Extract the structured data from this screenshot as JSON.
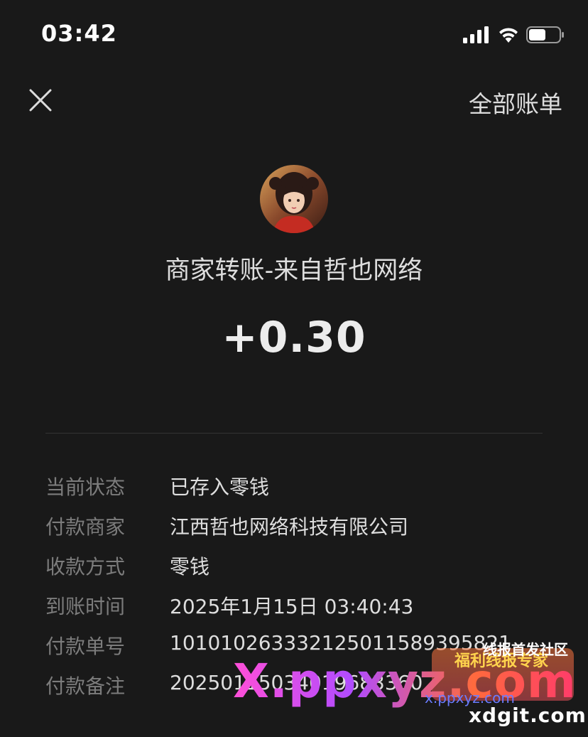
{
  "status_bar": {
    "time": "03:42",
    "signal_icon": "cellular-signal-icon",
    "wifi_icon": "wifi-icon",
    "battery_icon": "battery-icon",
    "battery_level": 0.55
  },
  "nav": {
    "close_icon": "close-icon",
    "all_bills_label": "全部账单"
  },
  "transaction": {
    "avatar_icon": "merchant-avatar",
    "title": "商家转账-来自哲也网络",
    "amount": "+0.30"
  },
  "details": [
    {
      "label": "当前状态",
      "value": "已存入零钱"
    },
    {
      "label": "付款商家",
      "value": "江西哲也网络科技有限公司"
    },
    {
      "label": "收款方式",
      "value": "零钱"
    },
    {
      "label": "到账时间",
      "value": "2025年1月15日 03:40:43"
    },
    {
      "label": "付款单号",
      "value": "101010263332125011589395821"
    },
    {
      "label": "付款备注",
      "value": "20250115034019683360"
    }
  ],
  "watermark": {
    "main": "X.ppxyz.com",
    "small": "x.ppxyz.com",
    "domain": "xdgit.com",
    "forum": "线报首发社区",
    "badge": "福利线报专家"
  },
  "colors": {
    "background": "#191919",
    "text_primary": "#dedede",
    "text_secondary": "#7c7c7c"
  }
}
